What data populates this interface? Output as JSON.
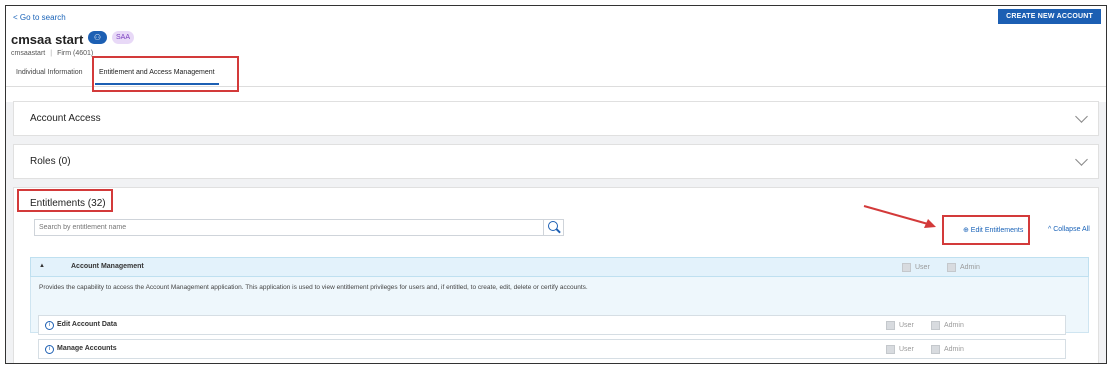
{
  "header": {
    "back_link": "< Go to search",
    "create_button": "CREATE NEW ACCOUNT",
    "account_name": "cmsaa start",
    "user_badge": "⚇",
    "saa_badge": "SAA",
    "username": "cmsaastart",
    "firm": "Firm (4601)"
  },
  "tabs": [
    {
      "label": "Individual Information"
    },
    {
      "label": "Entitlement and Access Management"
    }
  ],
  "panels": {
    "account_access": "Account Access",
    "roles": "Roles (0)",
    "entitlements": "Entitlements (32)"
  },
  "search": {
    "placeholder": "Search by entitlement name"
  },
  "actions": {
    "edit": "⊕ Edit Entitlements",
    "collapse": "^ Collapse All"
  },
  "account_management": {
    "toggle": "▲",
    "title": "Account Management",
    "description": "Provides the capability to access the Account Management application. This application is used to view entitlement privileges for users and, if entitled, to create, edit, delete or certify accounts.",
    "user_label": "User",
    "admin_label": "Admin",
    "items": [
      {
        "label": "Edit Account Data"
      },
      {
        "label": "Manage Accounts"
      }
    ]
  },
  "icons": {
    "info": "i"
  },
  "colors": {
    "accent": "#1c5fb3",
    "highlight": "#d33a3a"
  }
}
